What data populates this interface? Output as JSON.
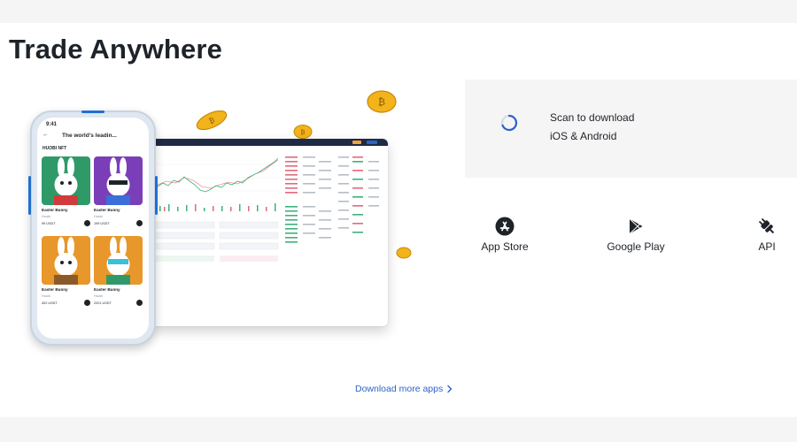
{
  "section": {
    "title": "Trade Anywhere"
  },
  "phone": {
    "time": "9:41",
    "header_title": "The world's leadin...",
    "brand": "HUOBI NFT",
    "cards": [
      {
        "name": "Easter Bunny",
        "meta": "Huobi",
        "price": "99 USDT",
        "bg": "#2f9a68"
      },
      {
        "name": "Easter Bunny",
        "meta": "Huobi",
        "price": "199 USDT",
        "bg": "#7a3fb8"
      },
      {
        "name": "Easter Bunny",
        "meta": "Huobi",
        "price": "402 USDT",
        "bg": "#e8972a"
      },
      {
        "name": "Easter Bunny",
        "meta": "Huobi",
        "price": "2201 USDT",
        "bg": "#e8972a"
      }
    ]
  },
  "download": {
    "scan_line1": "Scan to download",
    "scan_line2": "iOS & Android",
    "spinner_color": "#2b63c9"
  },
  "apps": [
    {
      "id": "app-store",
      "label": "App Store",
      "icon": "app-store-icon"
    },
    {
      "id": "google-play",
      "label": "Google Play",
      "icon": "google-play-icon"
    },
    {
      "id": "api",
      "label": "API",
      "icon": "api-plug-icon"
    }
  ],
  "more_apps": {
    "label": "Download more apps",
    "color": "#2b63c9"
  },
  "colors": {
    "coin": "#f2b31b",
    "panel_bg": "#f5f5f5",
    "text": "#1e2329"
  }
}
